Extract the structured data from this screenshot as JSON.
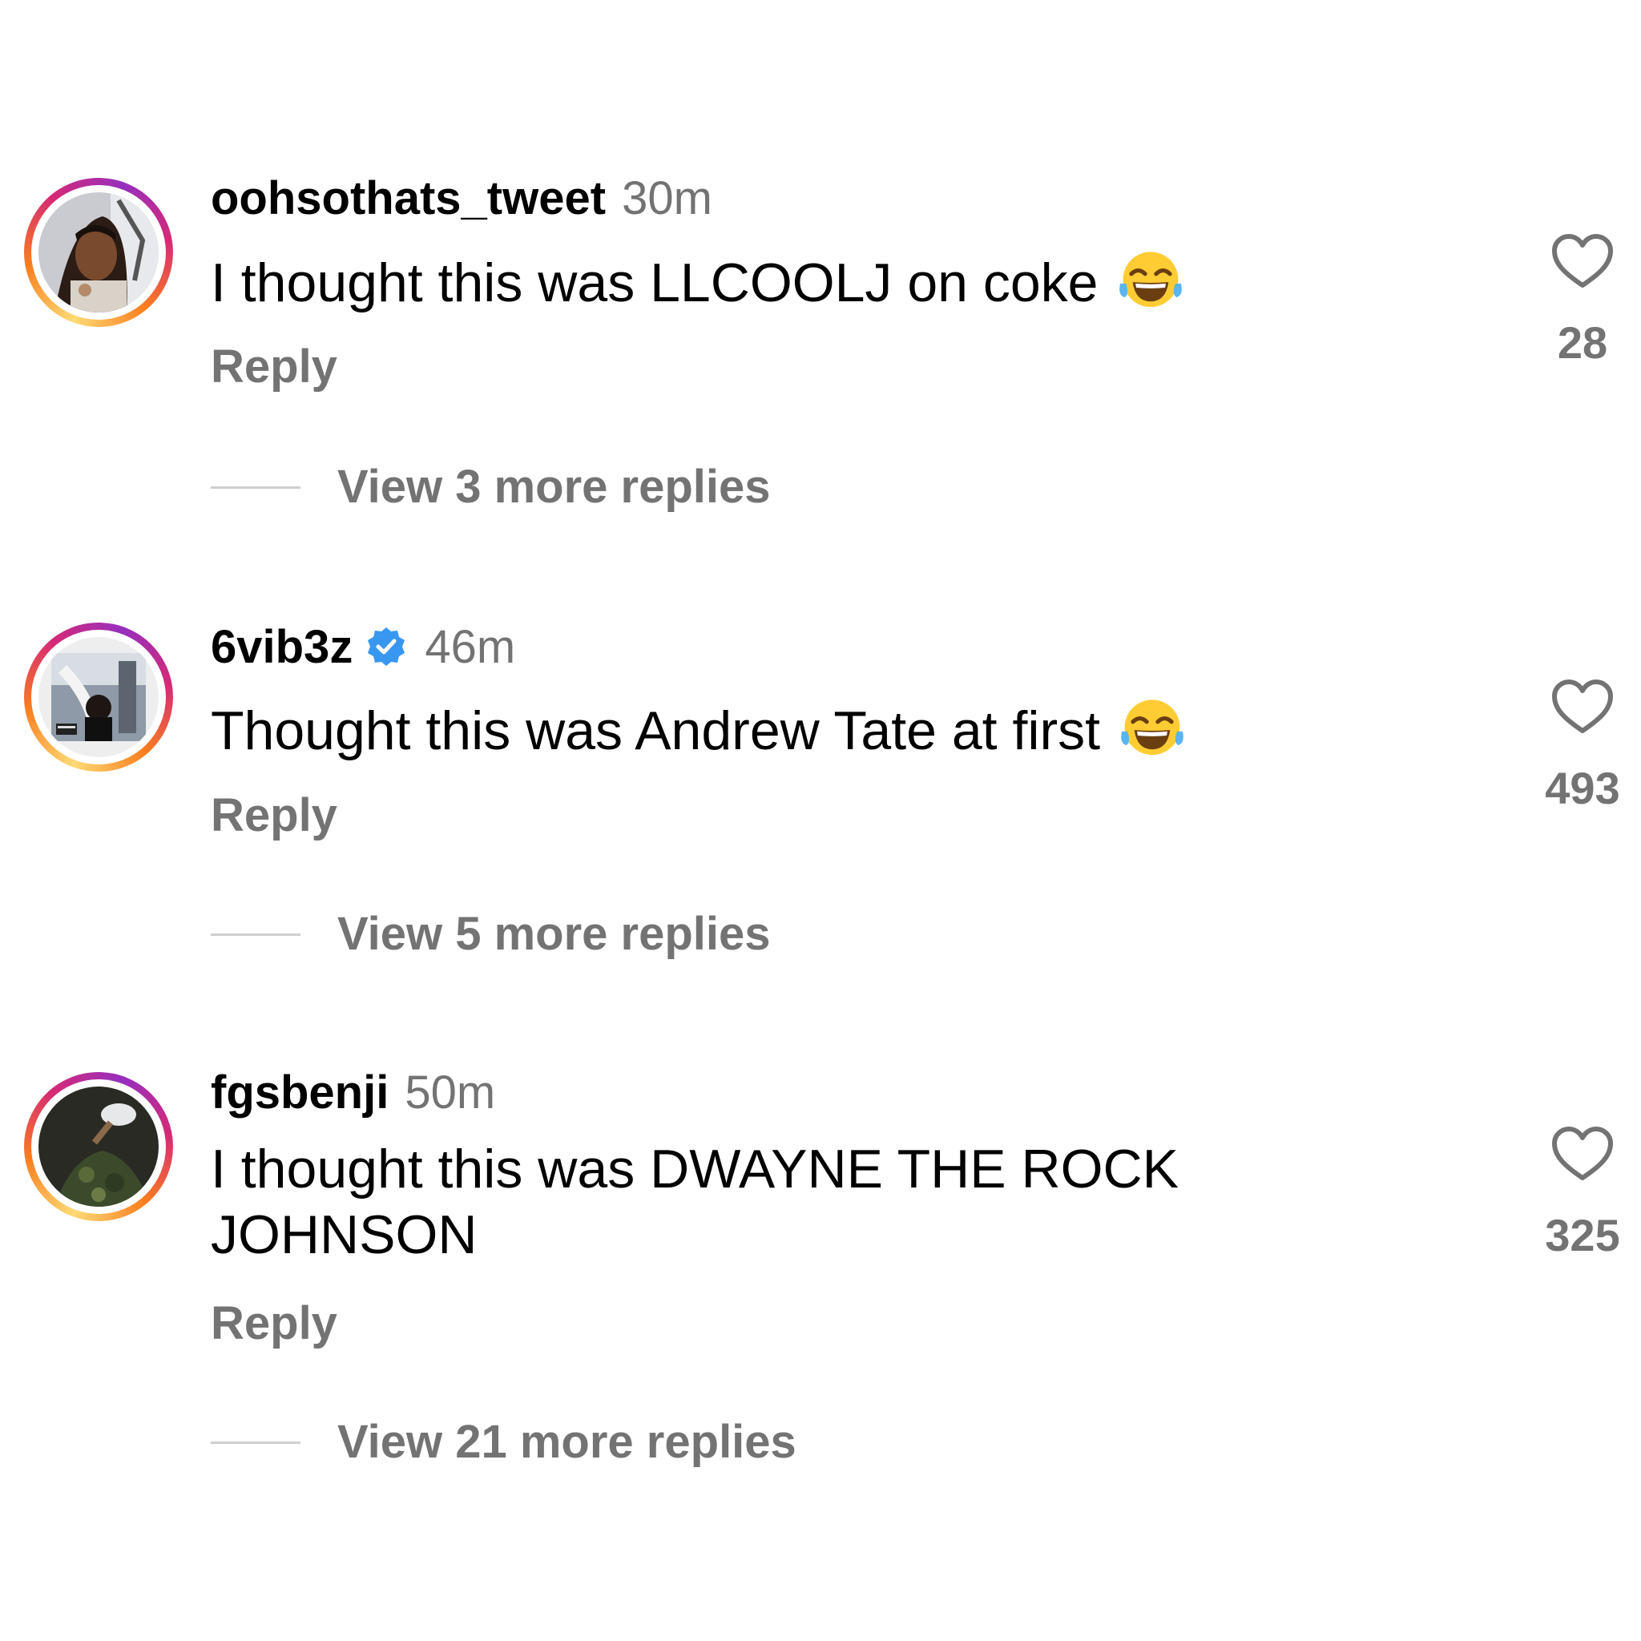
{
  "comments": [
    {
      "username": "oohsothats_tweet",
      "time": "30m",
      "verified": false,
      "text": "I thought this was LLCOOLJ on coke",
      "emoji": "tears-of-joy",
      "reply_label": "Reply",
      "view_replies": "View 3 more replies",
      "likes": "28",
      "avatar": "profile-photo"
    },
    {
      "username": "6vib3z",
      "time": "46m",
      "verified": true,
      "text": "Thought this was Andrew Tate at first",
      "emoji": "tears-of-joy",
      "reply_label": "Reply",
      "view_replies": "View 5 more replies",
      "likes": "493",
      "avatar": "album-cover-photo"
    },
    {
      "username": "fgsbenji",
      "time": "50m",
      "verified": false,
      "text": "I thought this was DWAYNE THE ROCK JOHNSON",
      "emoji": "",
      "reply_label": "Reply",
      "view_replies": "View 21 more replies",
      "likes": "325",
      "avatar": "profile-photo"
    }
  ],
  "colors": {
    "text": "#000000",
    "secondary": "#737373",
    "verified_blue": "#3897f0",
    "divider": "#cfcfcf"
  }
}
